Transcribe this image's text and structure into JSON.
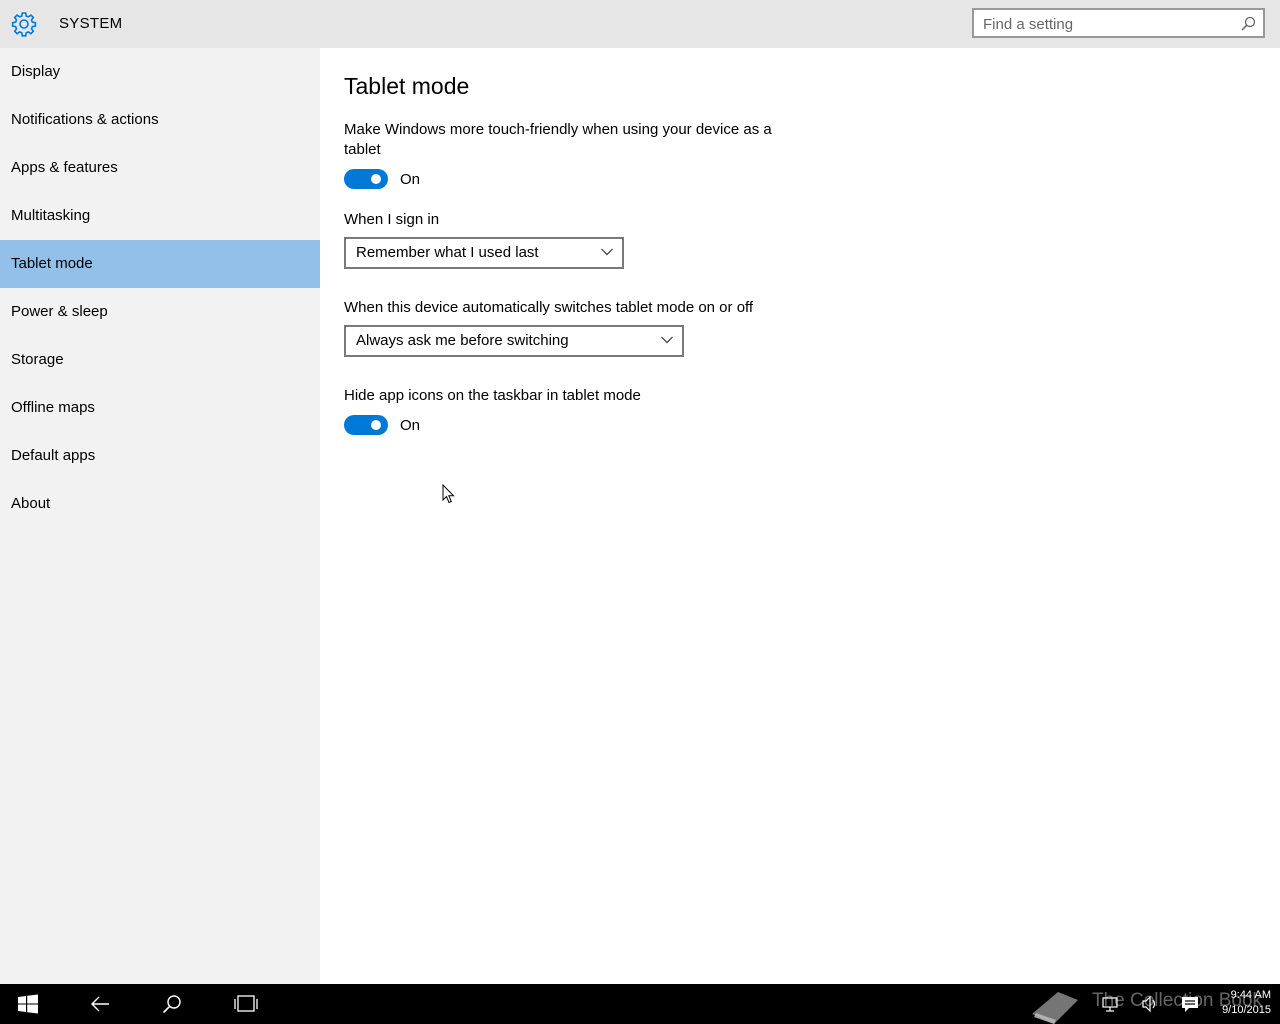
{
  "header": {
    "title": "SYSTEM",
    "search_placeholder": "Find a setting"
  },
  "sidebar": {
    "items": [
      {
        "label": "Display",
        "active": false
      },
      {
        "label": "Notifications & actions",
        "active": false
      },
      {
        "label": "Apps & features",
        "active": false
      },
      {
        "label": "Multitasking",
        "active": false
      },
      {
        "label": "Tablet mode",
        "active": true
      },
      {
        "label": "Power & sleep",
        "active": false
      },
      {
        "label": "Storage",
        "active": false
      },
      {
        "label": "Offline maps",
        "active": false
      },
      {
        "label": "Default apps",
        "active": false
      },
      {
        "label": "About",
        "active": false
      }
    ]
  },
  "main": {
    "title": "Tablet mode",
    "touch_friendly": {
      "label_line1": "Make Windows more touch-friendly when using your device as a",
      "label_line2": "tablet",
      "state": "On"
    },
    "sign_in": {
      "label": "When I sign in",
      "value": "Remember what I used last"
    },
    "auto_switch": {
      "label": "When this device automatically switches tablet mode on or off",
      "value": "Always ask me before switching"
    },
    "hide_icons": {
      "label": "Hide app icons on the taskbar in tablet mode",
      "state": "On"
    }
  },
  "taskbar": {
    "watermark": "The Collection Book",
    "time": "9:44 AM",
    "date": "9/10/2015"
  },
  "colors": {
    "accent": "#0078d7",
    "selected_nav": "#92c0e8",
    "sidebar_bg": "#f2f2f2",
    "header_bg": "#e6e6e6"
  },
  "icons": [
    "gear-icon",
    "search-icon",
    "chevron-down-icon",
    "windows-logo-icon",
    "back-arrow-icon",
    "search-icon",
    "task-view-icon",
    "network-icon",
    "volume-icon",
    "action-center-icon",
    "book-icon"
  ]
}
